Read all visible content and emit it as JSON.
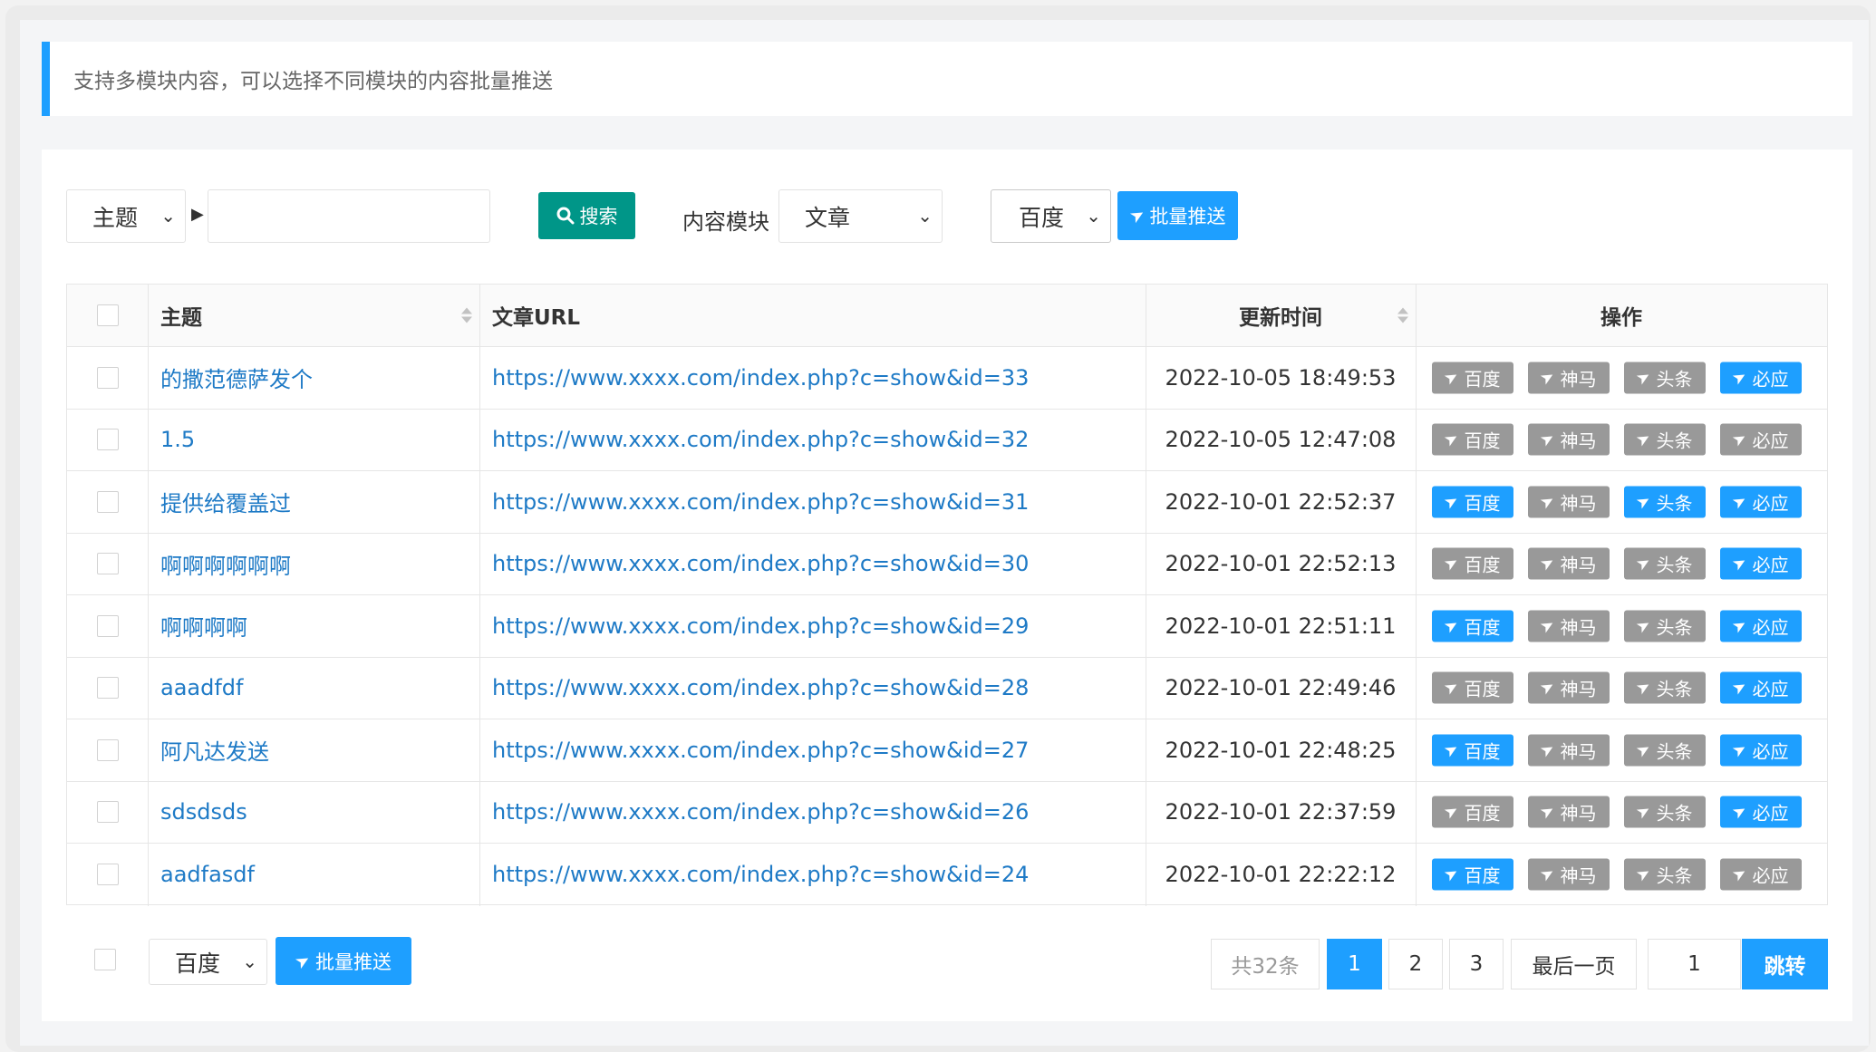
{
  "notice": "支持多模块内容，可以选择不同模块的内容批量推送",
  "toolbar": {
    "field_select": "主题",
    "search_label": "搜索",
    "module_label": "内容模块",
    "module_select": "文章",
    "engine_select": "百度",
    "batch_push_label": "批量推送"
  },
  "table": {
    "headers": {
      "title": "主题",
      "url": "文章URL",
      "time": "更新时间",
      "action": "操作"
    },
    "action_labels": [
      "百度",
      "神马",
      "头条",
      "必应"
    ],
    "rows": [
      {
        "title": "的撒范德萨发个",
        "url": "https://www.xxxx.com/index.php?c=show&id=33",
        "time": "2022-10-05 18:49:53",
        "pushed": [
          false,
          false,
          false,
          true
        ]
      },
      {
        "title": "1.5",
        "url": "https://www.xxxx.com/index.php?c=show&id=32",
        "time": "2022-10-05 12:47:08",
        "pushed": [
          false,
          false,
          false,
          false
        ]
      },
      {
        "title": "提供给覆盖过",
        "url": "https://www.xxxx.com/index.php?c=show&id=31",
        "time": "2022-10-01 22:52:37",
        "pushed": [
          true,
          false,
          true,
          true
        ]
      },
      {
        "title": "啊啊啊啊啊啊",
        "url": "https://www.xxxx.com/index.php?c=show&id=30",
        "time": "2022-10-01 22:52:13",
        "pushed": [
          false,
          false,
          false,
          true
        ]
      },
      {
        "title": "啊啊啊啊",
        "url": "https://www.xxxx.com/index.php?c=show&id=29",
        "time": "2022-10-01 22:51:11",
        "pushed": [
          true,
          false,
          false,
          true
        ]
      },
      {
        "title": "aaadfdf",
        "url": "https://www.xxxx.com/index.php?c=show&id=28",
        "time": "2022-10-01 22:49:46",
        "pushed": [
          false,
          false,
          false,
          true
        ]
      },
      {
        "title": "阿凡达发送",
        "url": "https://www.xxxx.com/index.php?c=show&id=27",
        "time": "2022-10-01 22:48:25",
        "pushed": [
          true,
          false,
          false,
          true
        ]
      },
      {
        "title": "sdsdsds",
        "url": "https://www.xxxx.com/index.php?c=show&id=26",
        "time": "2022-10-01 22:37:59",
        "pushed": [
          false,
          false,
          false,
          true
        ]
      },
      {
        "title": "aadfasdf",
        "url": "https://www.xxxx.com/index.php?c=show&id=24",
        "time": "2022-10-01 22:22:12",
        "pushed": [
          true,
          false,
          false,
          false
        ]
      }
    ]
  },
  "footer": {
    "engine_select": "百度",
    "batch_push_label": "批量推送"
  },
  "pagination": {
    "total": "共32条",
    "pages": [
      "1",
      "2",
      "3"
    ],
    "current": "1",
    "last": "最后一页",
    "jump_value": "1",
    "jump_label": "跳转"
  },
  "colors": {
    "pushed": "#1e9fff",
    "not_pushed": "#999999",
    "search": "#009688",
    "primary": "#1e9fff",
    "link": "#1e7ac6"
  }
}
